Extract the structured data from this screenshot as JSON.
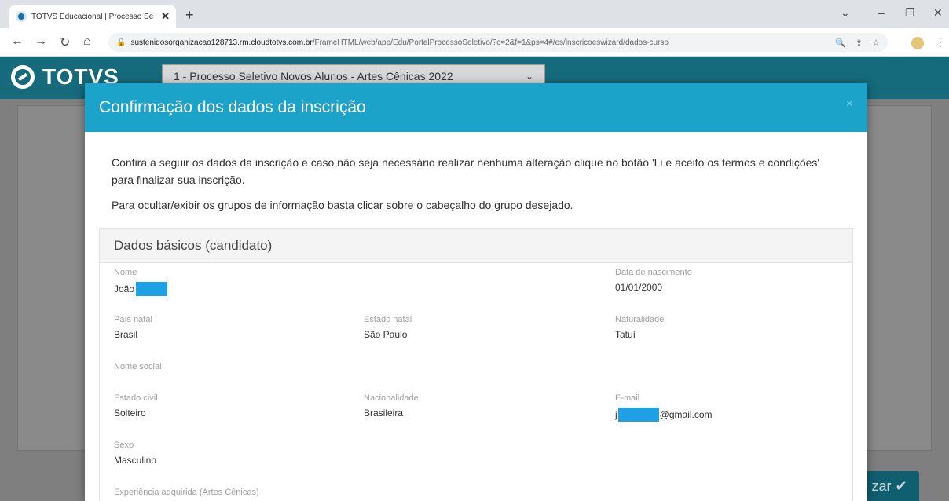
{
  "browser": {
    "tab_title": "TOTVS Educacional | Processo Se",
    "tab_close": "✕",
    "new_tab": "+",
    "url_domain": "sustenidosorganizacao128713.rm.cloudtotvs.com.br",
    "url_path": "/FrameHTML/web/app/Edu/PortalProcessoSeletivo/?c=2&f=1&ps=4#/es/inscricoeswizard/dados-curso",
    "icons": [
      "back-icon",
      "forward-icon",
      "reload-icon",
      "home-icon",
      "lock-icon",
      "zoom-icon",
      "share-icon",
      "star-icon",
      "profile-icon",
      "menu-icon"
    ]
  },
  "app": {
    "logo_text": "TOTVS",
    "process_select_value": "1 - Processo Seletivo Novos Alunos - Artes Cênicas 2022",
    "finish_button_label": "zar ✔"
  },
  "modal": {
    "title": "Confirmação dos dados da inscrição",
    "close_label": "×",
    "intro_1": "Confira a seguir os dados da inscrição e caso não seja necessário realizar nenhuma alteração clique no botão 'Li e aceito os termos e condições' para finalizar sua inscrição.",
    "intro_2": "Para ocultar/exibir os grupos de informação basta clicar sobre o cabeçalho do grupo desejado.",
    "group": {
      "title": "Dados básicos (candidato)",
      "fields": {
        "nome": {
          "label": "Nome",
          "value": "João"
        },
        "data_nascimento": {
          "label": "Data de nascimento",
          "value": "01/01/2000"
        },
        "pais_natal": {
          "label": "País natal",
          "value": "Brasil"
        },
        "estado_natal": {
          "label": "Estado natal",
          "value": "São Paulo"
        },
        "naturalidade": {
          "label": "Naturalidade",
          "value": "Tatuí"
        },
        "nome_social": {
          "label": "Nome social",
          "value": ""
        },
        "estado_civil": {
          "label": "Estado civil",
          "value": "Solteiro"
        },
        "nacionalidade": {
          "label": "Nacionalidade",
          "value": "Brasileira"
        },
        "email": {
          "label": "E-mail",
          "value_prefix": "j",
          "value_suffix": "@gmail.com"
        },
        "sexo": {
          "label": "Sexo",
          "value": "Masculino"
        },
        "experiencia": {
          "label": "Experiência adquirida (Artes Cênicas)"
        }
      }
    }
  },
  "colors": {
    "modal_header": "#1ba3c9",
    "app_header": "#156a7c",
    "redaction": "#1e9fe6",
    "overlay": "#7f7f7f"
  }
}
